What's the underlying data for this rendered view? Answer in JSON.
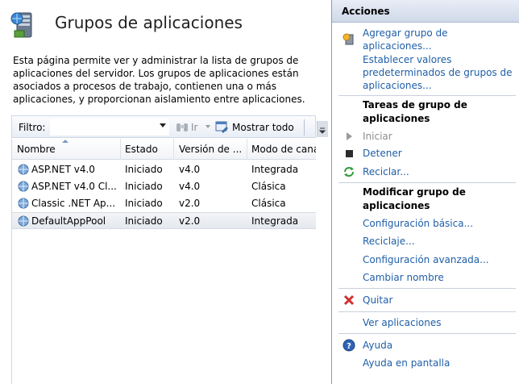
{
  "page": {
    "title": "Grupos de aplicaciones",
    "description": "Esta página permite ver y administrar la lista de grupos de aplicaciones del servidor. Los grupos de aplicaciones están asociados a procesos de trabajo, contienen una o más aplicaciones, y proporcionan aislamiento entre aplicaciones."
  },
  "toolbar": {
    "filter_label": "Filtro:",
    "filter_value": "",
    "go_label": "Ir",
    "show_all_label": "Mostrar todo"
  },
  "grid": {
    "columns": [
      "Nombre",
      "Estado",
      "Versión de ...",
      "Modo de cana"
    ],
    "rows": [
      {
        "name": "ASP.NET v4.0",
        "status": "Iniciado",
        "version": "v4.0",
        "mode": "Integrada"
      },
      {
        "name": "ASP.NET v4.0 Cl...",
        "status": "Iniciado",
        "version": "v4.0",
        "mode": "Clásica"
      },
      {
        "name": "Classic .NET Ap...",
        "status": "Iniciado",
        "version": "v2.0",
        "mode": "Clásica"
      },
      {
        "name": "DefaultAppPool",
        "status": "Iniciado",
        "version": "v2.0",
        "mode": "Integrada"
      }
    ],
    "selected_row": 3
  },
  "actions": {
    "title": "Acciones",
    "add_pool": "Agregar grupo de aplicaciones...",
    "set_defaults": "Establecer valores predeterminados de grupos de aplicaciones...",
    "tasks_heading": "Tareas de grupo de aplicaciones",
    "start": "Iniciar",
    "stop": "Detener",
    "recycle": "Reciclar...",
    "modify_heading": "Modificar grupo de aplicaciones",
    "basic_settings": "Configuración básica...",
    "recycling": "Reciclaje...",
    "advanced_settings": "Configuración avanzada...",
    "rename": "Cambiar nombre",
    "remove": "Quitar",
    "view_apps": "Ver aplicaciones",
    "help": "Ayuda",
    "online_help": "Ayuda en pantalla"
  },
  "colors": {
    "link": "#1f5ea8",
    "header_gradient_top": "#e8edf6",
    "header_gradient_bottom": "#cfd9e9",
    "remove_icon": "#d32f2f"
  }
}
